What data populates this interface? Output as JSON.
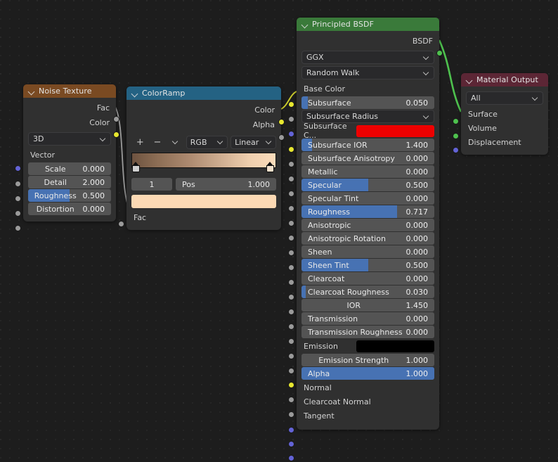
{
  "editor": {
    "background": "#1d1d1d"
  },
  "nodes": {
    "noise_texture": {
      "title": "Noise Texture",
      "header_color": "#7a4a22",
      "outputs": [
        {
          "name": "Fac",
          "socket": "gray"
        },
        {
          "name": "Color",
          "socket": "yellow"
        }
      ],
      "dimension_dropdown": "3D",
      "inputs": [
        {
          "name": "Vector",
          "socket": "purple",
          "type": "label"
        },
        {
          "name": "Scale",
          "value": "0.000",
          "socket": "gray",
          "fill": 0
        },
        {
          "name": "Detail",
          "value": "2.000",
          "socket": "gray",
          "fill": 0
        },
        {
          "name": "Roughness",
          "value": "0.500",
          "socket": "gray",
          "fill": 50
        },
        {
          "name": "Distortion",
          "value": "0.000",
          "socket": "gray",
          "fill": 0
        }
      ]
    },
    "color_ramp": {
      "title": "ColorRamp",
      "header_color": "#246283",
      "outputs": [
        {
          "name": "Color",
          "socket": "yellow"
        },
        {
          "name": "Alpha",
          "socket": "gray"
        }
      ],
      "buttons": {
        "add": "+",
        "remove": "−",
        "menu": "chevron-down"
      },
      "color_mode": "RGB",
      "interpolation": "Linear",
      "stop_index": "1",
      "pos_label": "Pos",
      "pos_value": "1.000",
      "selected_color": "#fcd9b4",
      "gradient_from": "#6e5340",
      "gradient_to": "#fbdcbb",
      "inputs": [
        {
          "name": "Fac",
          "socket": "gray"
        }
      ]
    },
    "principled_bsdf": {
      "title": "Principled BSDF",
      "header_color": "#3a7a3a",
      "outputs": [
        {
          "name": "BSDF",
          "socket": "green"
        }
      ],
      "distribution": "GGX",
      "subsurface_method": "Random Walk",
      "inputs": [
        {
          "name": "Base Color",
          "socket": "yellow",
          "type": "label"
        },
        {
          "name": "Subsurface",
          "value": "0.050",
          "socket": "gray",
          "type": "slider",
          "fill": 5
        },
        {
          "name": "Subsurface Radius",
          "socket": "purple",
          "type": "dropdown"
        },
        {
          "name": "Subsurface C...",
          "socket": "yellow",
          "type": "swatch",
          "color": "#ee0000"
        },
        {
          "name": "Subsurface IOR",
          "value": "1.400",
          "socket": "gray",
          "type": "slider",
          "fill": 8
        },
        {
          "name": "Subsurface Anisotropy",
          "value": "0.000",
          "socket": "gray",
          "type": "slider",
          "fill": 0
        },
        {
          "name": "Metallic",
          "value": "0.000",
          "socket": "gray",
          "type": "slider",
          "fill": 0
        },
        {
          "name": "Specular",
          "value": "0.500",
          "socket": "gray",
          "type": "slider",
          "fill": 50
        },
        {
          "name": "Specular Tint",
          "value": "0.000",
          "socket": "gray",
          "type": "slider",
          "fill": 0
        },
        {
          "name": "Roughness",
          "value": "0.717",
          "socket": "gray",
          "type": "slider",
          "fill": 72
        },
        {
          "name": "Anisotropic",
          "value": "0.000",
          "socket": "gray",
          "type": "slider",
          "fill": 0
        },
        {
          "name": "Anisotropic Rotation",
          "value": "0.000",
          "socket": "gray",
          "type": "slider",
          "fill": 0
        },
        {
          "name": "Sheen",
          "value": "0.000",
          "socket": "gray",
          "type": "slider",
          "fill": 0
        },
        {
          "name": "Sheen Tint",
          "value": "0.500",
          "socket": "gray",
          "type": "slider",
          "fill": 50
        },
        {
          "name": "Clearcoat",
          "value": "0.000",
          "socket": "gray",
          "type": "slider",
          "fill": 0
        },
        {
          "name": "Clearcoat Roughness",
          "value": "0.030",
          "socket": "gray",
          "type": "slider",
          "fill": 3
        },
        {
          "name": "IOR",
          "value": "1.450",
          "socket": "gray",
          "type": "slider",
          "fill": 0,
          "centered": true
        },
        {
          "name": "Transmission",
          "value": "0.000",
          "socket": "gray",
          "type": "slider",
          "fill": 0
        },
        {
          "name": "Transmission Roughness",
          "value": "0.000",
          "socket": "gray",
          "type": "slider",
          "fill": 0
        },
        {
          "name": "Emission",
          "socket": "yellow",
          "type": "swatch",
          "color": "#000000"
        },
        {
          "name": "Emission Strength",
          "value": "1.000",
          "socket": "gray",
          "type": "slider",
          "fill": 0
        },
        {
          "name": "Alpha",
          "value": "1.000",
          "socket": "gray",
          "type": "slider",
          "fill": 100
        },
        {
          "name": "Normal",
          "socket": "purple",
          "type": "label"
        },
        {
          "name": "Clearcoat Normal",
          "socket": "purple",
          "type": "label"
        },
        {
          "name": "Tangent",
          "socket": "purple",
          "type": "label"
        }
      ]
    },
    "material_output": {
      "title": "Material Output",
      "header_color": "#5c2635",
      "target": "All",
      "inputs": [
        {
          "name": "Surface",
          "socket": "green"
        },
        {
          "name": "Volume",
          "socket": "green"
        },
        {
          "name": "Displacement",
          "socket": "purple"
        }
      ]
    }
  }
}
